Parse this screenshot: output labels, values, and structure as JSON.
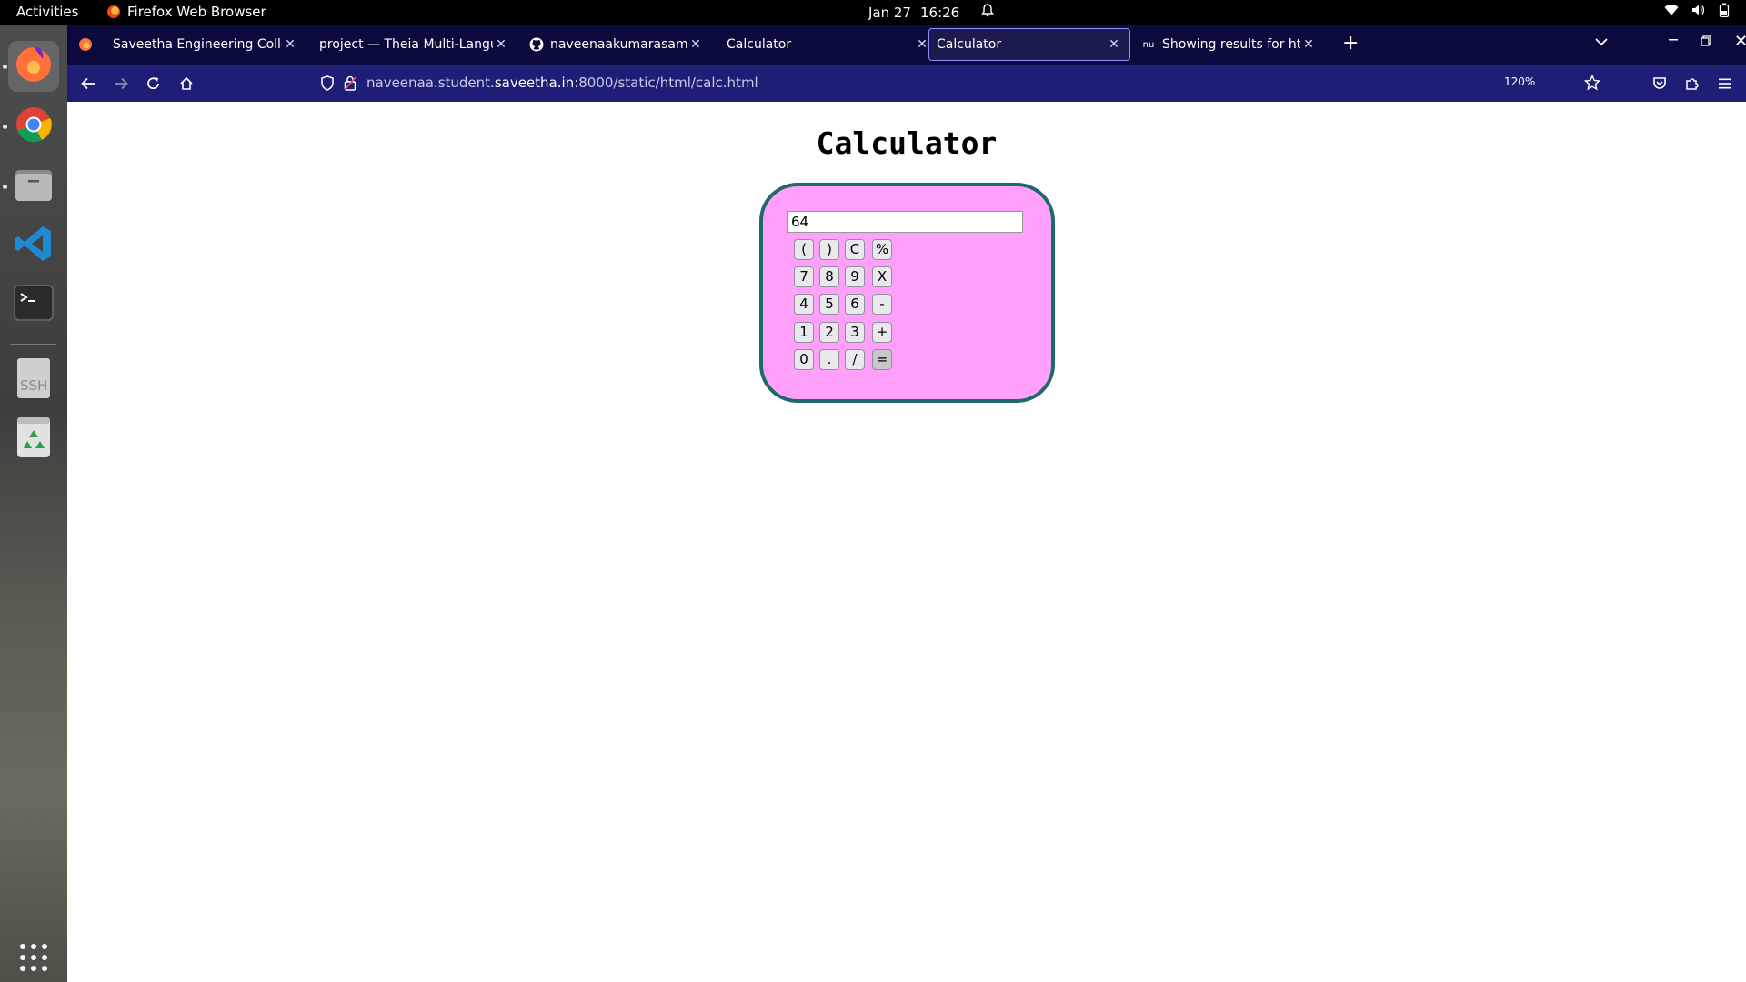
{
  "topbar": {
    "activities": "Activities",
    "app_name": "Firefox Web Browser",
    "date": "Jan 27",
    "time": "16:26"
  },
  "dock": {
    "items": [
      "firefox-icon",
      "chrome-icon",
      "files-icon",
      "vscode-icon",
      "terminal-icon",
      "ssh-key-icon",
      "trash-icon",
      "app-grid-icon"
    ]
  },
  "tabs": [
    {
      "label": "Saveetha Engineering College",
      "selected": false
    },
    {
      "label": "project — Theia Multi-Language",
      "selected": false
    },
    {
      "label": "naveenaakumarasamy/calc",
      "selected": false
    },
    {
      "label": "Calculator",
      "selected": false
    },
    {
      "label": "Calculator",
      "selected": true
    },
    {
      "label": "Showing results for http://",
      "selected": false
    }
  ],
  "navbar": {
    "url_prefix": "naveenaa.student.",
    "url_host": "saveetha.in",
    "url_suffix": ":8000/static/html/calc.html",
    "zoom": "120%"
  },
  "page": {
    "title": "Calculator",
    "display_value": "64",
    "buttons": [
      [
        "(",
        ")",
        "C",
        "%"
      ],
      [
        "7",
        "8",
        "9",
        "X"
      ],
      [
        "4",
        "5",
        "6",
        "-"
      ],
      [
        "1",
        "2",
        "3",
        "+"
      ],
      [
        "0",
        ".",
        "/",
        "="
      ]
    ]
  },
  "colors": {
    "tabbar_bg": "#0a0a3c",
    "navbar_bg": "#1f1e76",
    "calc_bg": "#ffa1fa",
    "calc_border": "#1e6a6a"
  }
}
